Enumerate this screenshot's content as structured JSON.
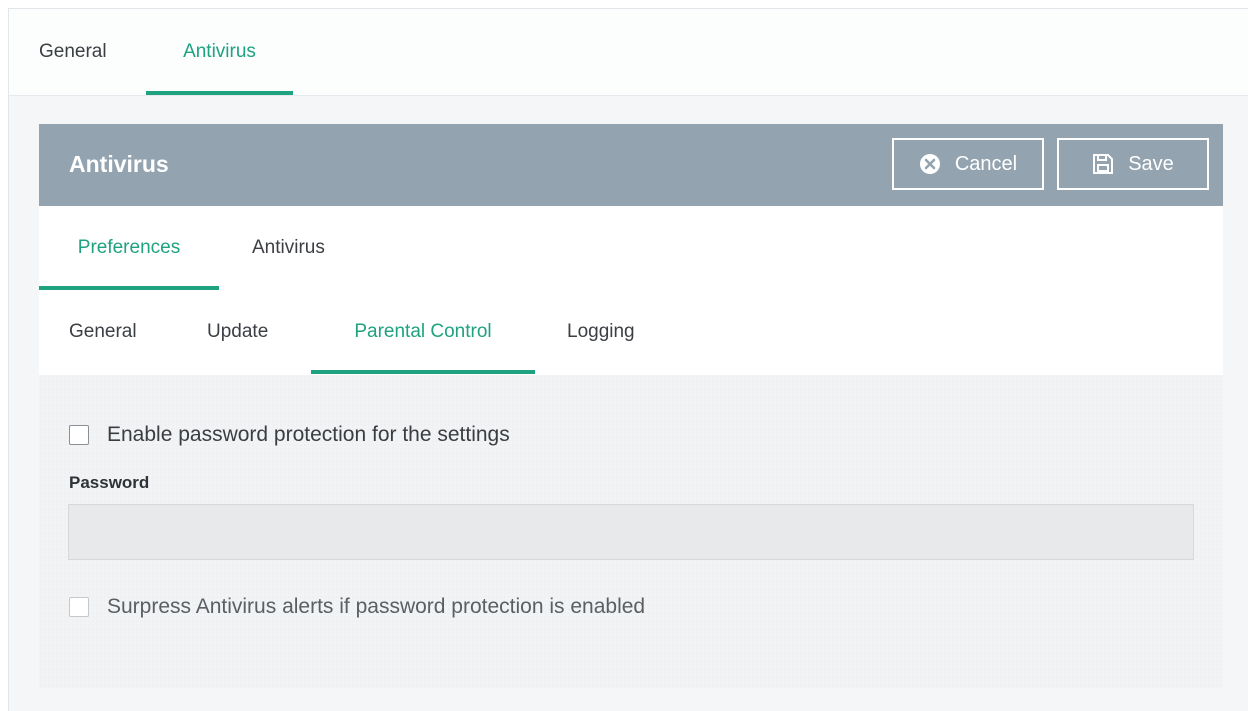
{
  "top_tabs": [
    {
      "label": "General",
      "active": false
    },
    {
      "label": "Antivirus",
      "active": true
    }
  ],
  "panel": {
    "title": "Antivirus",
    "cancel_label": "Cancel",
    "save_label": "Save"
  },
  "sub_tabs": [
    {
      "label": "Preferences",
      "active": true
    },
    {
      "label": "Antivirus",
      "active": false
    }
  ],
  "third_tabs": [
    {
      "label": "General",
      "active": false
    },
    {
      "label": "Update",
      "active": false
    },
    {
      "label": "Parental Control",
      "active": true
    },
    {
      "label": "Logging",
      "active": false
    }
  ],
  "form": {
    "enable_password_label": "Enable password protection for the settings",
    "enable_password_checked": false,
    "password_label": "Password",
    "password_value": "",
    "suppress_alerts_label": "Surpress Antivirus alerts if password protection is enabled",
    "suppress_alerts_checked": false
  },
  "colors": {
    "accent": "#1fa27f",
    "header_bg": "#93a4b0"
  },
  "icons": {
    "cancel": "close-circle-icon",
    "save": "floppy-disk-icon"
  }
}
